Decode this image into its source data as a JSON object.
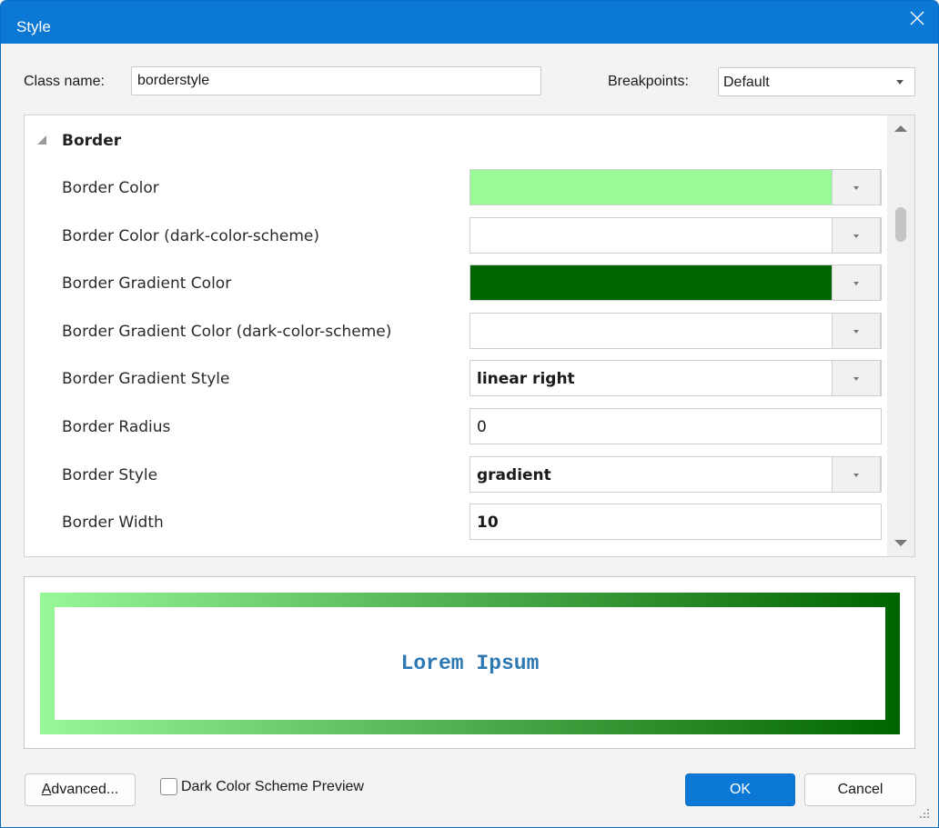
{
  "window": {
    "title": "Style",
    "close_icon": "close-icon"
  },
  "header": {
    "class_name_label": "Class name:",
    "class_name_value": "borderstyle",
    "breakpoints_label": "Breakpoints:",
    "breakpoints_value": "Default"
  },
  "grid": {
    "group_title": "Border",
    "properties": [
      {
        "name": "Border Color",
        "type": "color",
        "color": "#98fb98",
        "value": ""
      },
      {
        "name": "Border Color (dark-color-scheme)",
        "type": "color",
        "color": "#ffffff",
        "value": ""
      },
      {
        "name": "Border Gradient Color",
        "type": "color",
        "color": "#006400",
        "value": ""
      },
      {
        "name": "Border Gradient Color (dark-color-scheme)",
        "type": "color",
        "color": "#ffffff",
        "value": ""
      },
      {
        "name": "Border Gradient Style",
        "type": "select",
        "value": "linear right",
        "bold": true
      },
      {
        "name": "Border Radius",
        "type": "text",
        "value": "0",
        "bold": false
      },
      {
        "name": "Border Style",
        "type": "select",
        "value": "gradient",
        "bold": true
      },
      {
        "name": "Border Width",
        "type": "text",
        "value": "10",
        "bold": true
      }
    ]
  },
  "preview": {
    "text": "Lorem Ipsum",
    "gradient_start": "#98f898",
    "gradient_end": "#006400",
    "text_color": "#2f79b3"
  },
  "footer": {
    "advanced_label": "Advanced...",
    "dark_preview_label": "Dark Color Scheme Preview",
    "dark_preview_checked": false,
    "ok_label": "OK",
    "cancel_label": "Cancel"
  },
  "colors": {
    "accent": "#0a78d4"
  }
}
